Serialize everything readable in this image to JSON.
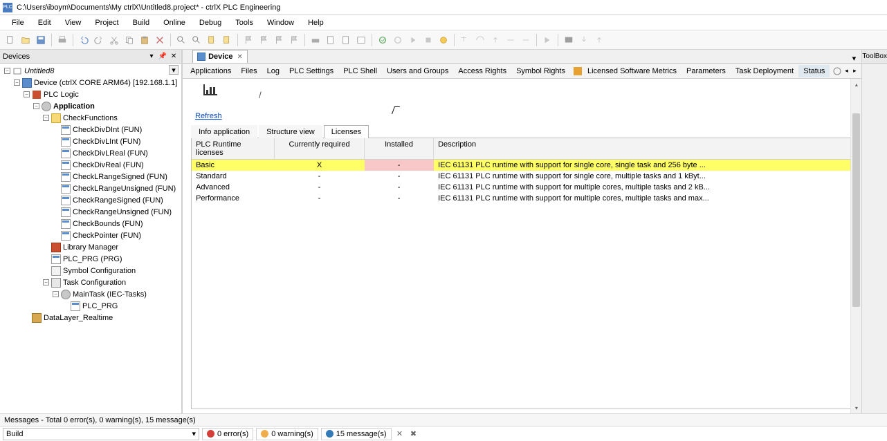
{
  "title": "C:\\Users\\iboym\\Documents\\My ctrlX\\Untitled8.project* - ctrlX PLC Engineering",
  "menu": [
    "File",
    "Edit",
    "View",
    "Project",
    "Build",
    "Online",
    "Debug",
    "Tools",
    "Window",
    "Help"
  ],
  "devices_panel": {
    "title": "Devices"
  },
  "tree": {
    "root": "Untitled8",
    "device": "Device (ctrlX CORE ARM64) [192.168.1.1]",
    "plc_logic": "PLC Logic",
    "application": "Application",
    "checkfunctions": "CheckFunctions",
    "funs": [
      "CheckDivDInt (FUN)",
      "CheckDivLInt (FUN)",
      "CheckDivLReal (FUN)",
      "CheckDivReal (FUN)",
      "CheckLRangeSigned (FUN)",
      "CheckLRangeUnsigned (FUN)",
      "CheckRangeSigned (FUN)",
      "CheckRangeUnsigned (FUN)",
      "CheckBounds (FUN)",
      "CheckPointer (FUN)"
    ],
    "library_manager": "Library Manager",
    "plc_prg": "PLC_PRG (PRG)",
    "symbol_config": "Symbol Configuration",
    "task_config": "Task Configuration",
    "maintask": "MainTask (IEC-Tasks)",
    "plc_prg2": "PLC_PRG",
    "datalayer": "DataLayer_Realtime"
  },
  "doc_tab": {
    "label": "Device"
  },
  "inner_tabs": [
    "Applications",
    "Files",
    "Log",
    "PLC Settings",
    "PLC Shell",
    "Users and Groups",
    "Access Rights",
    "Symbol Rights",
    "Licensed Software Metrics",
    "Parameters",
    "Task Deployment",
    "Status"
  ],
  "slash": "/",
  "refresh": "Refresh",
  "sub_tabs": [
    "Info application",
    "Structure view",
    "Licenses"
  ],
  "lic_headers": [
    "PLC Runtime licenses",
    "Currently required",
    "Installed",
    "Description"
  ],
  "lic_rows": [
    {
      "name": "Basic",
      "req": "X",
      "inst": "-",
      "desc": "IEC 61131 PLC runtime with support for single core, single task and 256 byte ...",
      "hl": true
    },
    {
      "name": "Standard",
      "req": "-",
      "inst": "-",
      "desc": "IEC 61131 PLC runtime with support for single core, multiple tasks and 1 kByt...",
      "hl": false
    },
    {
      "name": "Advanced",
      "req": "-",
      "inst": "-",
      "desc": "IEC 61131 PLC runtime with support for multiple cores, multiple tasks and 2 kB...",
      "hl": false
    },
    {
      "name": "Performance",
      "req": "-",
      "inst": "-",
      "desc": "IEC 61131 PLC runtime with support for multiple cores, multiple tasks and max...",
      "hl": false
    }
  ],
  "toolbox_title": "ToolBox",
  "messages_bar": "Messages - Total 0 error(s), 0 warning(s), 15 message(s)",
  "build_combo": "Build",
  "errors_chip": "0 error(s)",
  "warnings_chip": "0 warning(s)",
  "messages_chip": "15 message(s)"
}
